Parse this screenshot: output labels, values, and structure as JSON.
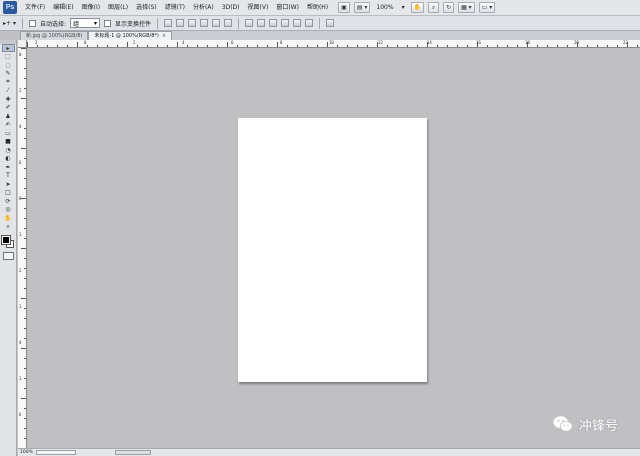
{
  "app": {
    "logo": "Ps"
  },
  "menu": {
    "items": [
      "文件(F)",
      "编辑(E)",
      "图像(I)",
      "图层(L)",
      "选择(S)",
      "滤镜(T)",
      "分析(A)",
      "3D(D)",
      "视图(V)",
      "窗口(W)",
      "帮助(H)"
    ],
    "zoom": "100%"
  },
  "options": {
    "auto_select_label": "自动选择:",
    "auto_select_value": "组",
    "show_transform_label": "显示变换控件"
  },
  "tabs": [
    {
      "label": "新.jpg @ 100%(RGB/8)",
      "active": false
    },
    {
      "label": "未标题-1 @ 100%(RGB/8*)",
      "active": true,
      "close": "×"
    }
  ],
  "ruler": {
    "top_numbers": [
      "2",
      "0",
      "2",
      "4",
      "6",
      "8",
      "10",
      "12",
      "14",
      "16",
      "18",
      "20",
      "22"
    ],
    "left_numbers": [
      "0",
      "2",
      "4",
      "6",
      "8",
      "1",
      "2",
      "1",
      "4",
      "1",
      "6"
    ]
  },
  "status": {
    "zoom": "100%"
  },
  "watermark": {
    "text": "冲锋号",
    "icon": "wechat-icon"
  },
  "colors": {
    "workspace": "#c0bfc2",
    "document": "#ffffff",
    "foreground": "#000000",
    "background": "#ffffff"
  }
}
